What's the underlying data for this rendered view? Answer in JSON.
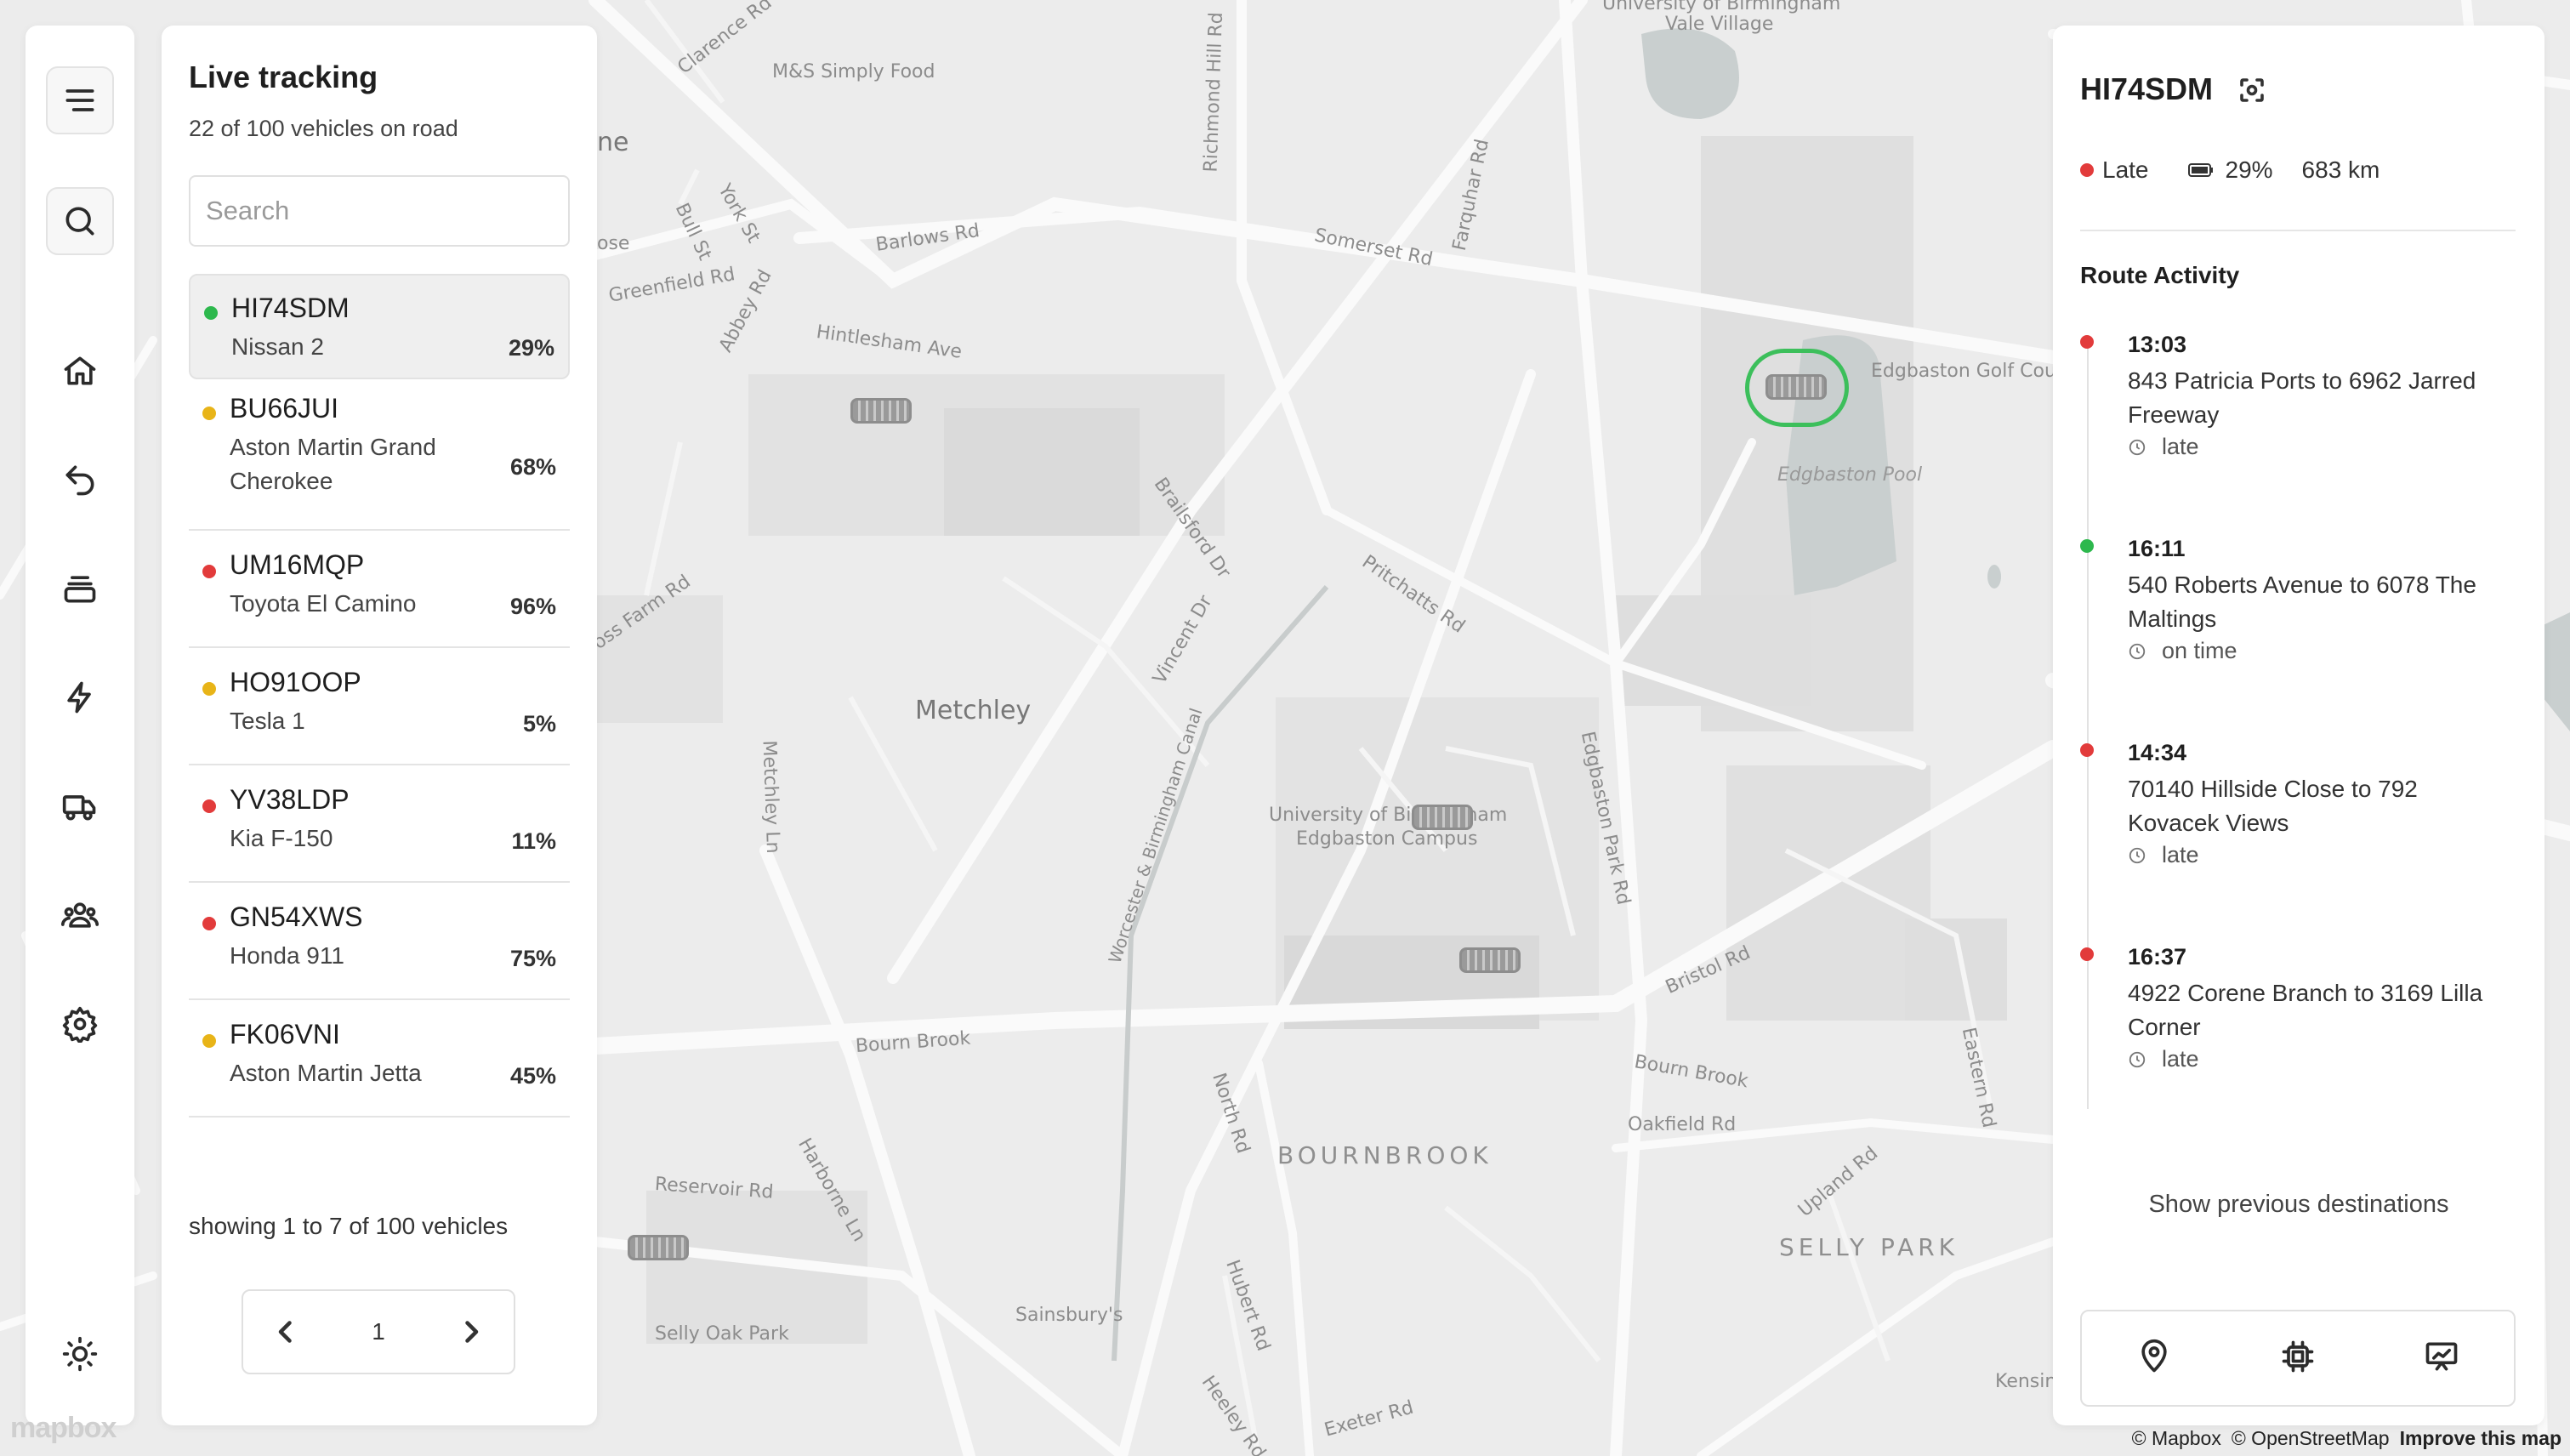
{
  "map": {
    "labels": {
      "ms_simply_food": "M&S Simply Food",
      "clarence_rd": "Clarence Rd",
      "richmond_hill_rd": "Richmond Hill Rd",
      "university_vale": "University of Birmingham",
      "vale_village": "Vale Village",
      "barlows_rd": "Barlows Rd",
      "somerset_rd": "Somerset Rd",
      "farquhar_rd": "Farquhar Rd",
      "york_st": "York St",
      "bull_st": "Bull St",
      "greenfield_rd": "Greenfield Rd",
      "abbey_rd": "Abbey Rd",
      "hintlesham_ave": "Hintlesham Ave",
      "edgbaston_golf": "Edgbaston Golf Cours",
      "edgbaston_pool": "Edgbaston Pool",
      "brailsford_dr": "Brailsford Dr",
      "pritchatts_rd": "Pritchatts Rd",
      "vincent_dr": "Vincent Dr",
      "metchley": "Metchley",
      "canal": "Worcester & Birmingham Canal",
      "metchley_ln": "Metchley Ln",
      "edgbaston_park_rd": "Edgbaston Park Rd",
      "university_campus": "University of Birmingham",
      "edgbaston_campus": "Edgbaston Campus",
      "bristol_rd": "Bristol Rd",
      "bourn_brook": "Bourn Brook",
      "bourn_brook_2": "Bourn Brook",
      "north_rd": "North Rd",
      "bournbrook": "BOURNBROOK",
      "oakfield_rd": "Oakfield Rd",
      "upland_rd": "Upland Rd",
      "eastern_rd": "Eastern Rd",
      "harborne_ln": "Harborne Ln",
      "reservoir_rd": "Reservoir Rd",
      "selly_oak_park": "Selly Oak Park",
      "sainsburys": "Sainsbury's",
      "hubert_rd": "Hubert Rd",
      "heeley_rd": "Heeley Rd",
      "exeter_rd": "Exeter Rd",
      "selly_park": "SELLY PARK",
      "moss_farm_rd": "oss Farm Rd",
      "kensin": "Kensin",
      "edge_ne": "ne",
      "edge_ose": "ose"
    }
  },
  "rail": {
    "icons": [
      "menu-icon",
      "search-icon",
      "home-icon",
      "undo-icon",
      "archive-icon",
      "bolt-icon",
      "truck-icon",
      "users-icon",
      "gear-icon",
      "sun-icon"
    ]
  },
  "list": {
    "title": "Live tracking",
    "subtitle": "22 of 100 vehicles on road",
    "search_placeholder": "Search",
    "vehicles": [
      {
        "plate": "HI74SDM",
        "model": "Nissan 2",
        "pct": "29%",
        "status": "green",
        "selected": true
      },
      {
        "plate": "BU66JUI",
        "model": "Aston Martin Grand Cherokee",
        "pct": "68%",
        "status": "amber",
        "selected": false
      },
      {
        "plate": "UM16MQP",
        "model": "Toyota El Camino",
        "pct": "96%",
        "status": "red",
        "selected": false
      },
      {
        "plate": "HO91OOP",
        "model": "Tesla 1",
        "pct": "5%",
        "status": "amber",
        "selected": false
      },
      {
        "plate": "YV38LDP",
        "model": "Kia F-150",
        "pct": "11%",
        "status": "red",
        "selected": false
      },
      {
        "plate": "GN54XWS",
        "model": "Honda 911",
        "pct": "75%",
        "status": "red",
        "selected": false
      },
      {
        "plate": "FK06VNI",
        "model": "Aston Martin Jetta",
        "pct": "45%",
        "status": "amber",
        "selected": false
      }
    ],
    "showing": "showing 1 to 7 of 100 vehicles",
    "page": "1"
  },
  "detail": {
    "plate": "HI74SDM",
    "status": "Late",
    "battery": "29%",
    "range": "683 km",
    "route_title": "Route Activity",
    "stops": [
      {
        "time": "13:03",
        "route": "843 Patricia Ports to 6962 Jarred Freeway",
        "status": "late",
        "color": "red"
      },
      {
        "time": "16:11",
        "route": "540 Roberts Avenue to 6078 The Maltings",
        "status": "on time",
        "color": "green"
      },
      {
        "time": "14:34",
        "route": "70140 Hillside Close to 792 Kovacek Views",
        "status": "late",
        "color": "red"
      },
      {
        "time": "16:37",
        "route": "4922 Corene Branch to 3169 Lilla Corner",
        "status": "late",
        "color": "red"
      }
    ],
    "show_previous": "Show previous destinations",
    "actions": [
      "map-pin-icon",
      "chip-icon",
      "chart-icon"
    ]
  },
  "attribution": {
    "logo": "mapbox",
    "mapbox": "© Mapbox",
    "osm": "© OpenStreetMap",
    "improve": "Improve this map"
  },
  "colors": {
    "green": "#2db84d",
    "amber": "#e8b418",
    "red": "#e23b3b",
    "ring": "#3cbf5b"
  }
}
